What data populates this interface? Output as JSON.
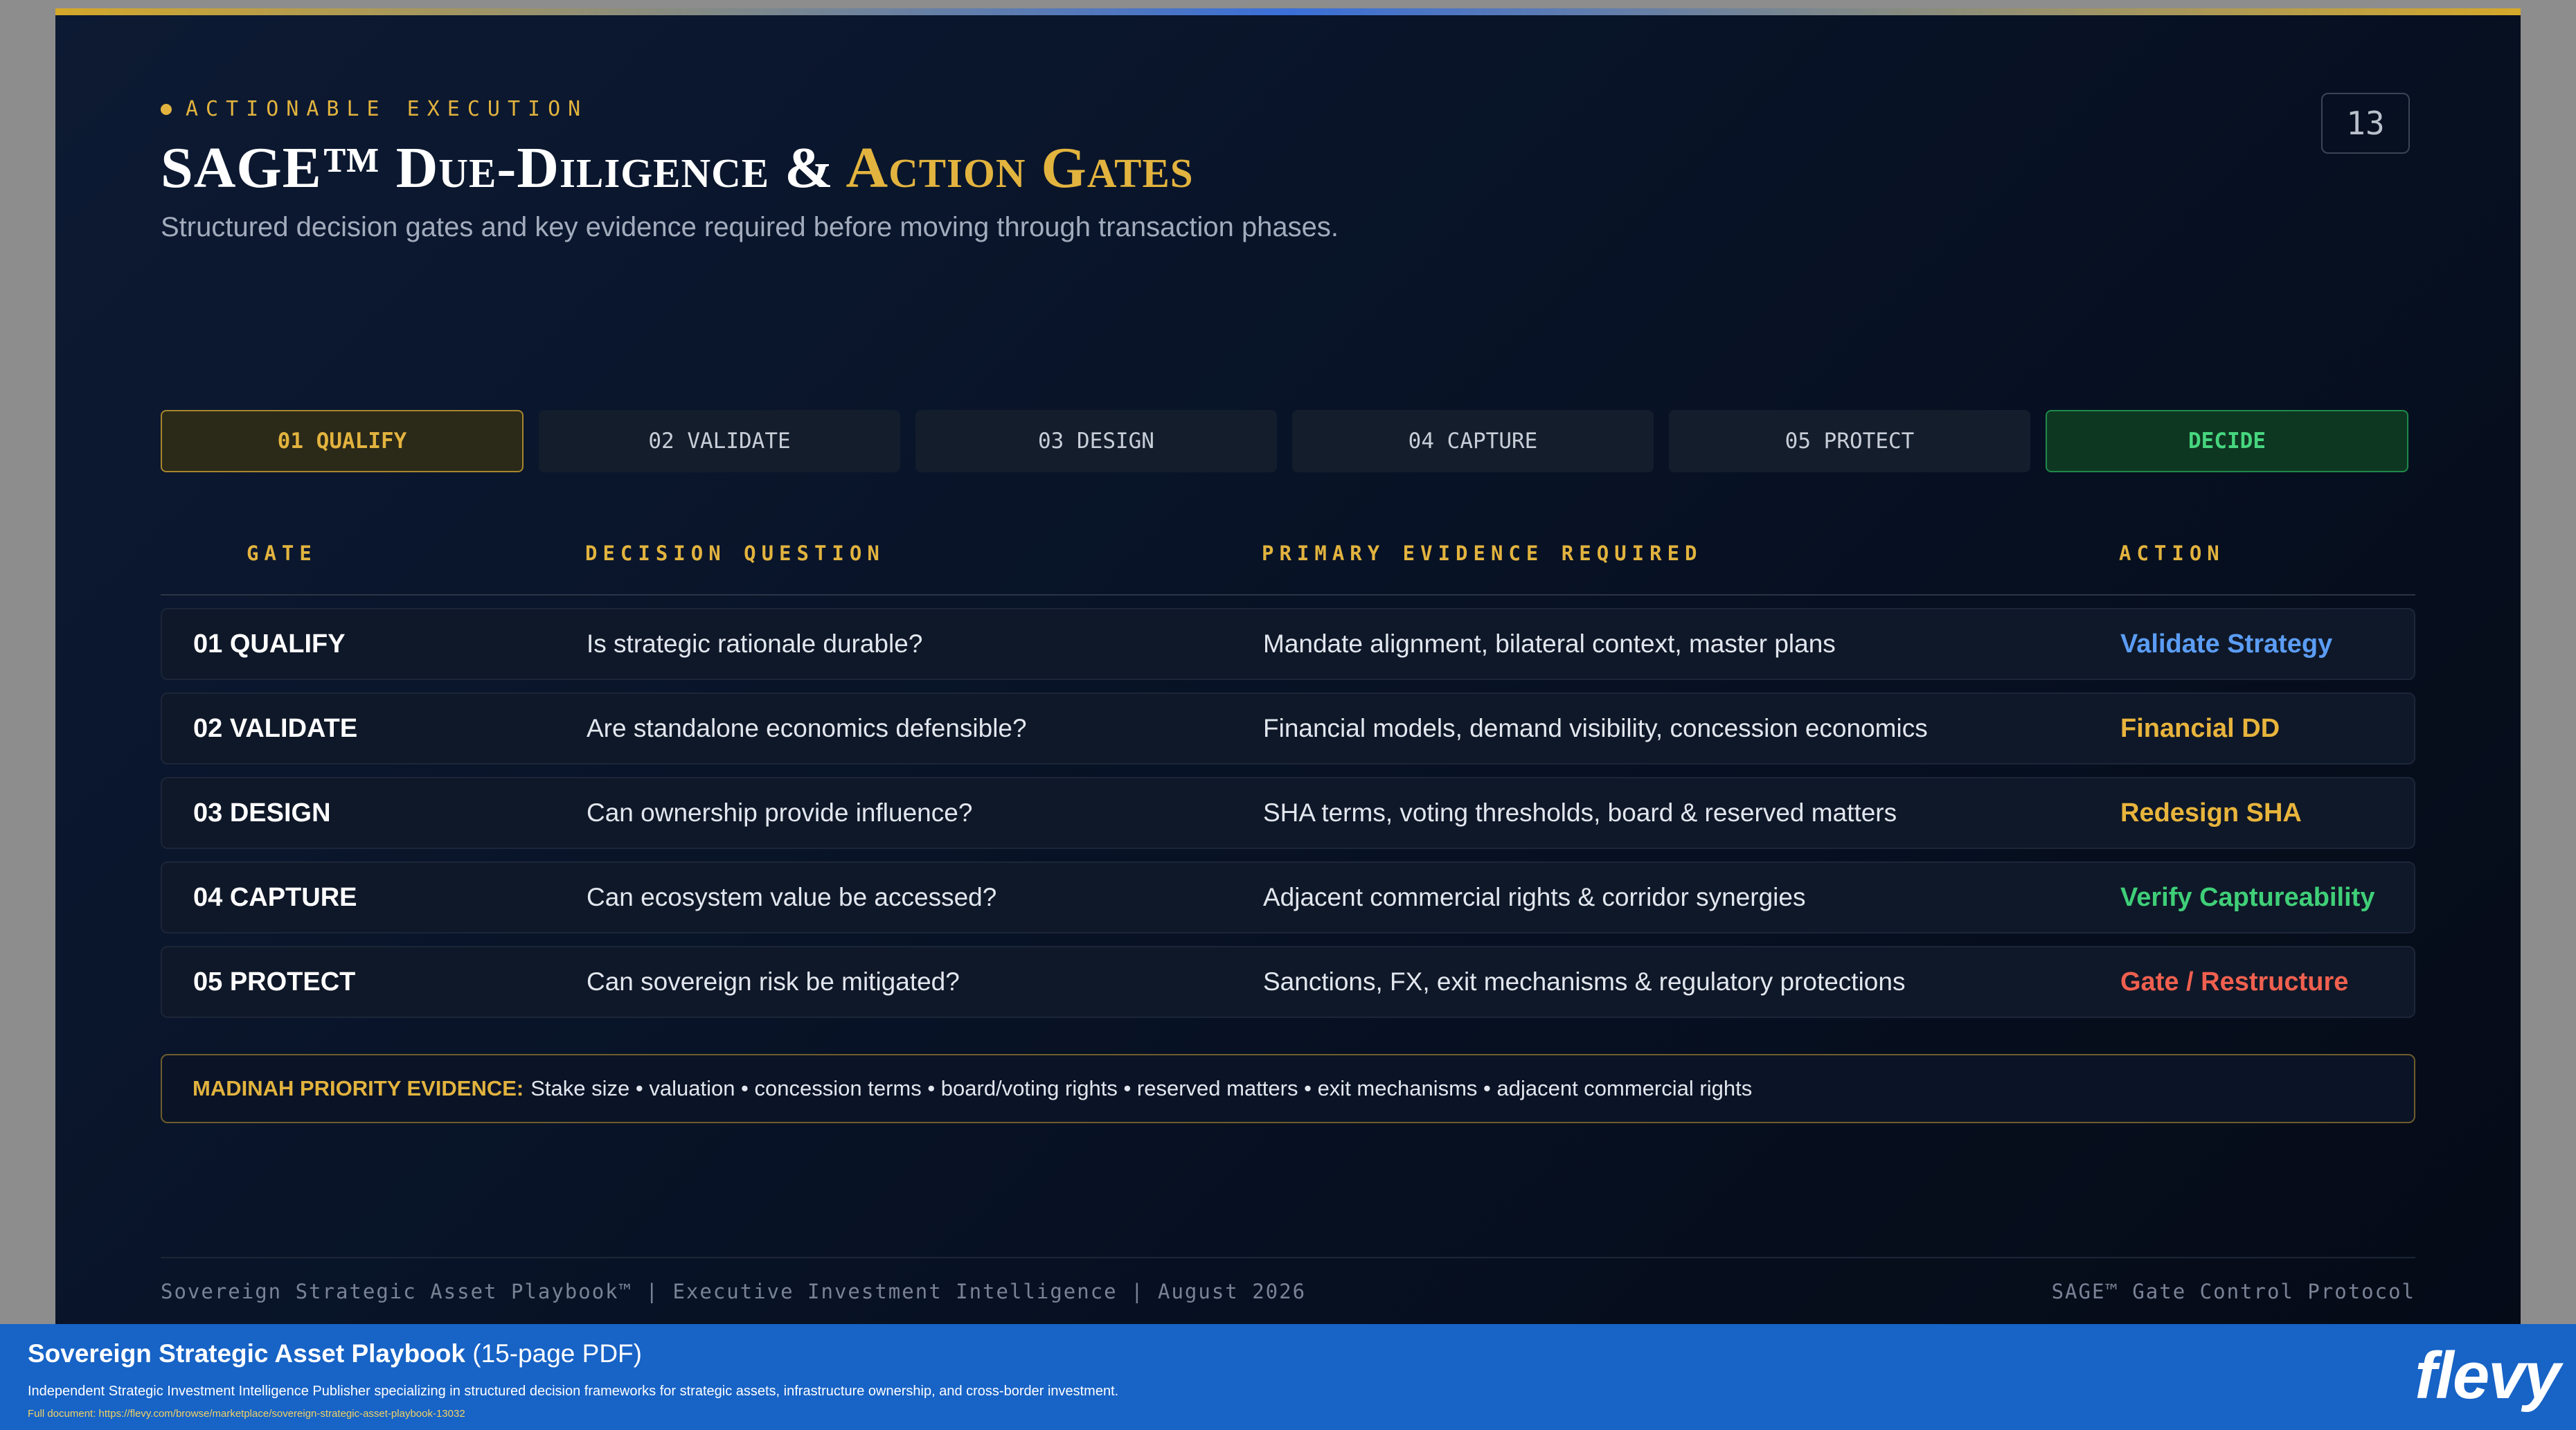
{
  "slide": {
    "eyebrow": "ACTIONABLE EXECUTION",
    "title_main": "SAGE™ Due-Diligence & ",
    "title_accent": "Action Gates",
    "subtitle": "Structured decision gates and key evidence required before moving through transaction phases.",
    "page_number": "13"
  },
  "tabs": [
    {
      "label": "01 QUALIFY",
      "state": "active"
    },
    {
      "label": "02 VALIDATE",
      "state": "default"
    },
    {
      "label": "03 DESIGN",
      "state": "default"
    },
    {
      "label": "04 CAPTURE",
      "state": "default"
    },
    {
      "label": "05 PROTECT",
      "state": "default"
    },
    {
      "label": "DECIDE",
      "state": "decide"
    }
  ],
  "table": {
    "headers": [
      "GATE",
      "DECISION QUESTION",
      "PRIMARY EVIDENCE REQUIRED",
      "ACTION"
    ],
    "rows": [
      {
        "gate": "01 QUALIFY",
        "question": "Is strategic rationale durable?",
        "evidence": "Mandate alignment, bilateral context, master plans",
        "action": "Validate Strategy",
        "action_color": "#5b9df5"
      },
      {
        "gate": "02 VALIDATE",
        "question": "Are standalone economics defensible?",
        "evidence": "Financial models, demand visibility, concession economics",
        "action": "Financial DD",
        "action_color": "#e8b43c"
      },
      {
        "gate": "03 DESIGN",
        "question": "Can ownership provide influence?",
        "evidence": "SHA terms, voting thresholds, board & reserved matters",
        "action": "Redesign SHA",
        "action_color": "#e8b43c"
      },
      {
        "gate": "04 CAPTURE",
        "question": "Can ecosystem value be accessed?",
        "evidence": "Adjacent commercial rights & corridor synergies",
        "action": "Verify Captureability",
        "action_color": "#3fcf78"
      },
      {
        "gate": "05 PROTECT",
        "question": "Can sovereign risk be mitigated?",
        "evidence": "Sanctions, FX, exit mechanisms & regulatory protections",
        "action": "Gate / Restructure",
        "action_color": "#f0604f"
      }
    ]
  },
  "priority_evidence": {
    "label": "MADINAH PRIORITY EVIDENCE:",
    "text": "Stake size • valuation • concession terms • board/voting rights • reserved matters • exit mechanisms • adjacent commercial rights"
  },
  "footer": {
    "left": "Sovereign Strategic Asset Playbook™ | Executive Investment Intelligence | August 2026",
    "right": "SAGE™ Gate Control Protocol"
  },
  "banner": {
    "title_main": "Sovereign Strategic Asset Playbook",
    "title_suffix": " (15-page PDF)",
    "description": "Independent Strategic Investment Intelligence Publisher specializing in structured decision frameworks for strategic assets, infrastructure ownership, and cross-border investment.",
    "link": "Full document: https://flevy.com/browse/marketplace/sovereign-strategic-asset-playbook-13032",
    "logo": "flevy"
  }
}
